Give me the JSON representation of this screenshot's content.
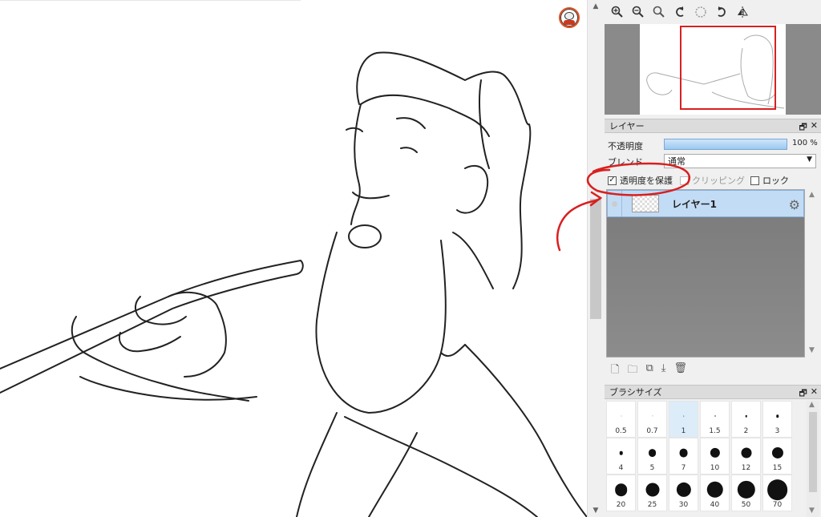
{
  "layer_panel": {
    "title": "レイヤー",
    "opacity_label": "不透明度",
    "opacity_value": "100 %",
    "opacity_fraction": 1.0,
    "blend_label": "ブレンド",
    "blend_value": "通常",
    "protect_alpha_label": "透明度を保護",
    "protect_alpha_checked": true,
    "clipping_label": "クリッピング",
    "lock_label": "ロック",
    "layers": [
      {
        "name": "レイヤー1"
      }
    ]
  },
  "panel_controls": {
    "restore": "🗗",
    "close": "✕"
  },
  "brush_panel": {
    "title": "ブラシサイズ",
    "sizes": [
      "0.5",
      "0.7",
      "1",
      "1.5",
      "2",
      "3",
      "4",
      "5",
      "7",
      "10",
      "12",
      "15",
      "20",
      "25",
      "30",
      "40",
      "50",
      "70"
    ],
    "selected": "1"
  },
  "icons": [
    "zoom-in-icon",
    "zoom-out-icon",
    "zoom-reset-icon",
    "rotate-left-icon",
    "rotate-reset-icon",
    "rotate-right-icon",
    "flip-horizontal-icon"
  ],
  "colors": {
    "annotation": "#d82020",
    "layer_selected": "#c3dcf5",
    "accent": "#86b1df"
  }
}
